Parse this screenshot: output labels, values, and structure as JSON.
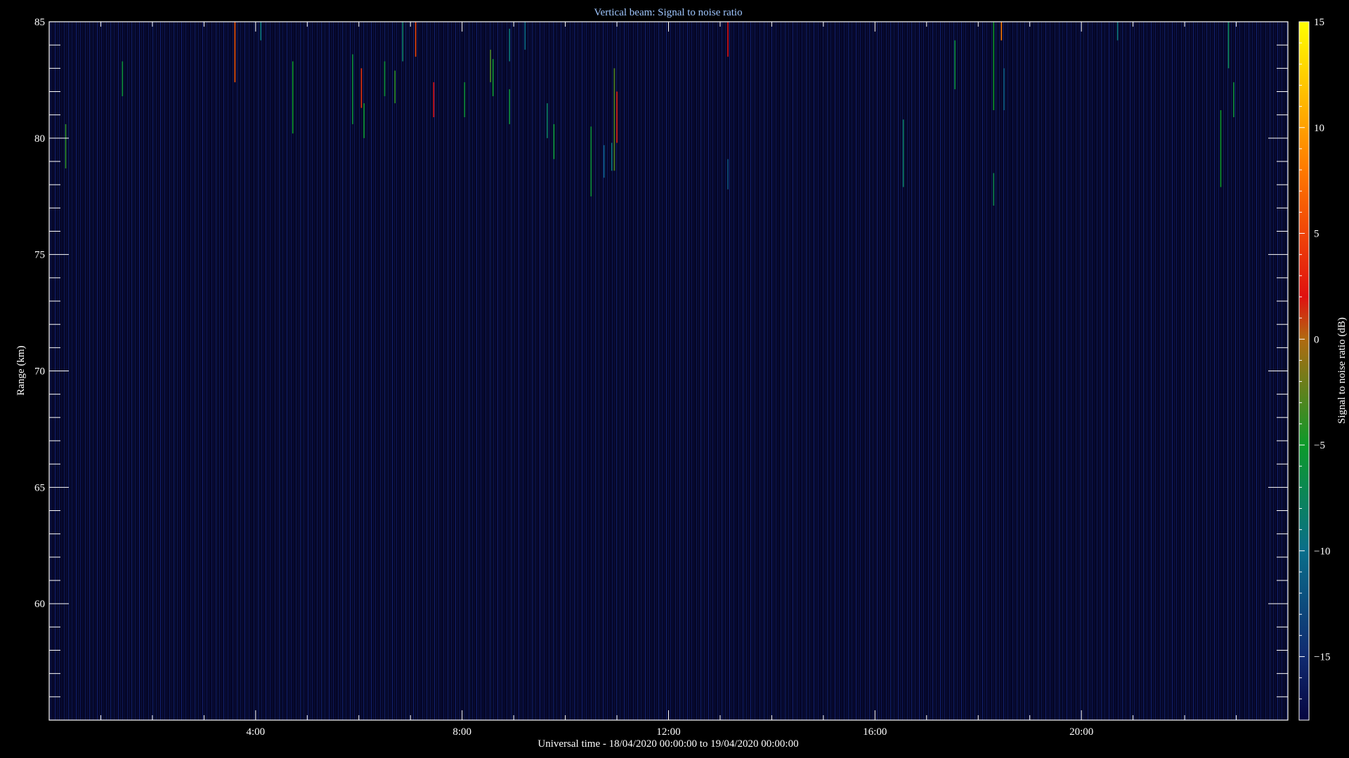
{
  "chart_data": {
    "type": "heatmap",
    "title": "Vertical beam: Signal to noise ratio",
    "xlabel": "Universal time - 18/04/2020 00:00:00 to 19/04/2020 00:00:00",
    "ylabel": "Range (km)",
    "colorbar_label": "Signal to noise ratio (dB)",
    "x_unit": "hours UT",
    "xlim": [
      0,
      24
    ],
    "ylim": [
      55,
      85
    ],
    "x_major_ticks": [
      4,
      8,
      12,
      16,
      20
    ],
    "x_tick_labels": [
      "4:00",
      "8:00",
      "12:00",
      "16:00",
      "20:00"
    ],
    "y_major_ticks": [
      60,
      65,
      70,
      75,
      80,
      85
    ],
    "y_tick_labels": [
      "60",
      "65",
      "70",
      "75",
      "80",
      "85"
    ],
    "colorbar_range": [
      -18,
      15
    ],
    "colorbar_ticks": [
      15,
      10,
      5,
      0,
      -5,
      -10,
      -15
    ],
    "colorbar_tick_labels": [
      "15",
      "10",
      "5",
      "0",
      "−5",
      "−10",
      "−15"
    ],
    "colormap": [
      {
        "value": -18,
        "color": "#060640"
      },
      {
        "value": -15,
        "color": "#102a70"
      },
      {
        "value": -10,
        "color": "#0a6e8a"
      },
      {
        "value": -5,
        "color": "#0c9a2a"
      },
      {
        "value": 0,
        "color": "#b06a10"
      },
      {
        "value": 2,
        "color": "#e01010"
      },
      {
        "value": 8,
        "color": "#ff7a00"
      },
      {
        "value": 15,
        "color": "#ffff00"
      }
    ],
    "background_snr_db": -16,
    "streaks": [
      {
        "t": 0.32,
        "r0": 78.7,
        "r1": 80.6,
        "snr": -4
      },
      {
        "t": 1.42,
        "r0": 81.8,
        "r1": 83.3,
        "snr": -6
      },
      {
        "t": 3.6,
        "r0": 82.4,
        "r1": 85.0,
        "snr": 6
      },
      {
        "t": 4.1,
        "r0": 84.2,
        "r1": 85.0,
        "snr": -9
      },
      {
        "t": 4.72,
        "r0": 80.2,
        "r1": 83.3,
        "snr": -5
      },
      {
        "t": 5.88,
        "r0": 80.6,
        "r1": 83.6,
        "snr": -6
      },
      {
        "t": 6.05,
        "r0": 81.3,
        "r1": 83.0,
        "snr": 4
      },
      {
        "t": 6.1,
        "r0": 80.0,
        "r1": 81.5,
        "snr": -5
      },
      {
        "t": 6.5,
        "r0": 81.8,
        "r1": 83.3,
        "snr": -6
      },
      {
        "t": 6.7,
        "r0": 81.5,
        "r1": 82.9,
        "snr": -4
      },
      {
        "t": 6.85,
        "r0": 83.3,
        "r1": 85.0,
        "snr": -8
      },
      {
        "t": 7.1,
        "r0": 83.5,
        "r1": 85.0,
        "snr": 5
      },
      {
        "t": 7.45,
        "r0": 80.9,
        "r1": 82.4,
        "snr": 2
      },
      {
        "t": 8.05,
        "r0": 80.9,
        "r1": 82.4,
        "snr": -6
      },
      {
        "t": 8.55,
        "r0": 82.4,
        "r1": 83.8,
        "snr": -3
      },
      {
        "t": 8.6,
        "r0": 81.8,
        "r1": 83.4,
        "snr": -5
      },
      {
        "t": 8.92,
        "r0": 83.3,
        "r1": 84.7,
        "snr": -9
      },
      {
        "t": 8.92,
        "r0": 80.6,
        "r1": 82.1,
        "snr": -6
      },
      {
        "t": 9.22,
        "r0": 83.8,
        "r1": 85.0,
        "snr": -10
      },
      {
        "t": 9.65,
        "r0": 80.0,
        "r1": 81.5,
        "snr": -8
      },
      {
        "t": 9.78,
        "r0": 79.1,
        "r1": 80.6,
        "snr": -5
      },
      {
        "t": 10.5,
        "r0": 77.5,
        "r1": 80.5,
        "snr": -6
      },
      {
        "t": 10.75,
        "r0": 78.3,
        "r1": 79.7,
        "snr": -11
      },
      {
        "t": 10.9,
        "r0": 78.6,
        "r1": 79.8,
        "snr": -9
      },
      {
        "t": 10.95,
        "r0": 78.6,
        "r1": 83.0,
        "snr": -3
      },
      {
        "t": 11.0,
        "r0": 79.8,
        "r1": 82.0,
        "snr": 3
      },
      {
        "t": 13.15,
        "r0": 83.5,
        "r1": 85.0,
        "snr": 2
      },
      {
        "t": 13.15,
        "r0": 77.8,
        "r1": 79.1,
        "snr": -12
      },
      {
        "t": 16.55,
        "r0": 77.9,
        "r1": 80.8,
        "snr": -8
      },
      {
        "t": 17.55,
        "r0": 82.1,
        "r1": 84.2,
        "snr": -6
      },
      {
        "t": 18.3,
        "r0": 81.2,
        "r1": 85.0,
        "snr": -5
      },
      {
        "t": 18.3,
        "r0": 77.1,
        "r1": 78.5,
        "snr": -7
      },
      {
        "t": 18.45,
        "r0": 84.2,
        "r1": 85.0,
        "snr": 8
      },
      {
        "t": 18.5,
        "r0": 81.2,
        "r1": 83.0,
        "snr": -11
      },
      {
        "t": 20.7,
        "r0": 84.2,
        "r1": 85.0,
        "snr": -9
      },
      {
        "t": 22.7,
        "r0": 77.9,
        "r1": 81.2,
        "snr": -5
      },
      {
        "t": 22.85,
        "r0": 83.0,
        "r1": 85.0,
        "snr": -7
      },
      {
        "t": 22.95,
        "r0": 80.9,
        "r1": 82.4,
        "snr": -6
      }
    ]
  }
}
